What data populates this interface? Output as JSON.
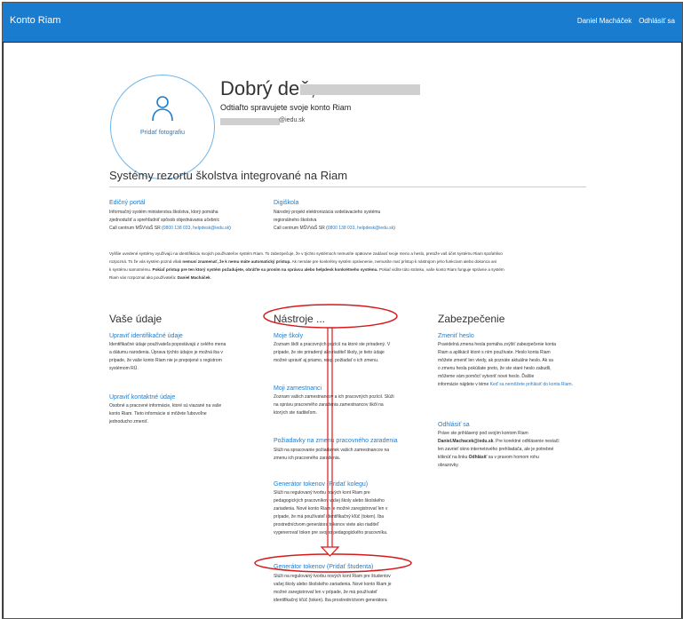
{
  "header": {
    "brand": "Konto Riam",
    "user_name": "Daniel Macháček",
    "logout": "Odhlásiť sa"
  },
  "profile": {
    "add_photo": "Pridať fotografiu",
    "greeting": "Dobrý deň,",
    "subtitle": "Odtiaľto spravujete svoje konto Riam",
    "email_suffix": "@iedu.sk"
  },
  "systems": {
    "title": "Systémy rezortu školstva integrované na Riam",
    "items": [
      {
        "title": "Edičný portál",
        "line1": "Informačný systém ministerstva školstva, ktorý pomáha",
        "line2": "zjednodušiť a sprehľadniť spôsob objednávania učebníc",
        "line3_prefix": "Call centrum MŠVVaŠ SR (",
        "line3_link": "0800 138 033, helpdesk@iedu.sk",
        "line3_suffix": ")"
      },
      {
        "title": "Digiškola",
        "line1": "Národný projekt elektronizácia vzdelávacieho systému",
        "line2": "regionálneho školstva",
        "line3_prefix": "Call centrum MŠVVaŠ SR (",
        "line3_link": "0800 138 033, helpdesk@iedu.sk",
        "line3_suffix": ")"
      }
    ],
    "note": {
      "line1": "Vyššie uvedené systémy využívajú na identifikáciu svojich používateľov systém Riam. To zabezpečuje, že v týchto systémoch nemusíte opätovne zadávať svoje meno a heslo, pretože vaš účet systému Riam spoľahlivo",
      "line2_a": "rozpozná. To že vás systém pozná však ",
      "line2_bold": "nemusí znamenať, že k nemu máte automatický prístup.",
      "line2_b": " Ak nemáte pre konkrétny systém oprávnenie, nemusíte mať prístup k nástrojom jeho funkcíam alebo dokonca ani",
      "line3_a": "k systému samotnému. ",
      "line3_bold": "Pokiaľ prístup pre ten ktorý systém požadujete, obráťte sa prosím na správcu alebo helpdesk konkrétneho systému.",
      "line3_b": " Pokiaľ vidíte túto stránku, vaše konto Riam funguje správne a systém",
      "line4_a": "Riam vás rozpoznal ako používateľa: ",
      "line4_bold": "Daniel Macháček",
      "line4_b": "."
    }
  },
  "columns": {
    "udaje": {
      "title": "Vaše údaje",
      "items": [
        {
          "title": "Upraviť identifikačné údaje",
          "lines": [
            "Identifikačné údaje používateľa popostávajú z celého mena",
            "a dátumu narodenia. Úprava týchto údajov je možná iba v",
            "prípade, že vaše konto Riam nie je prepojené s registrom",
            "systémom RÚ."
          ]
        },
        {
          "title": "Upraviť kontaktné údaje",
          "lines": [
            "Osobné a pracovné informácie, ktoré sú viazané na vaše",
            "konto Riam. Tieto informácie si môžete ľubovoľne",
            "jednoducho zmeniť."
          ]
        }
      ]
    },
    "nastroje": {
      "title": "Nástroje ...",
      "items": [
        {
          "title": "Moje školy",
          "lines": [
            "Zoznam škôl a pracovných pozícií na ktoré ste priradený. V",
            "prípade, že ste priradený ako riaditeľ školy, je tieto údaje",
            "možné upraviť aj priamo, resp. požiadať o ich zmenu."
          ]
        },
        {
          "title": "Moji zamestnanci",
          "lines": [
            "Zoznam vašich zamestnancov a ich pracovných pozícií. Slúži",
            "na správu pracovného zaradenia zamestnancov škôl na",
            "ktorých ste riaditeľom."
          ]
        },
        {
          "title": "Požiadavky na zmenu pracovného zaradenia",
          "lines": [
            "Slúži na spracovanie požiadaviek vašich zamestnancov na",
            "zmenu ich pracovného zaradenia."
          ]
        },
        {
          "title": "Generátor tokenov (Pridať kolegu)",
          "lines": [
            "Slúži na regulovaný tvorbu nových kont Riam pre",
            "pedagogických pracovníkov vašej školy alebo školského",
            "zariadenia. Nové konto Riam je možné zaregistrovať len v",
            "prípade, že má používateľ identifikačný kľúč (token). Iba",
            "prostredníctvom generátora tokenov viete ako riaditeľ",
            "vygenerovať token pre svojho pedagogického pracovníka."
          ]
        },
        {
          "title": "Generátor tokenov (Pridať študenta)",
          "lines": [
            "Slúži na regulovaný tvorbu nových kont Riam pre študentov",
            "vašej školy alebo školského zariadenia. Nové konto Riam je",
            "možné zaregistrovať len v prípade, že má používateľ",
            "identifikačný kľúč (token). Iba prostredníctvom generátora"
          ]
        }
      ]
    },
    "zabezpecenie": {
      "title": "Zabezpečenie",
      "items": [
        {
          "title": "Zmeniť heslo",
          "lines": [
            "Pravidelná zmena hesla pomáha zvýšiť zabezpečenie konta",
            "Riam a aplikácií ktoré s ním používate. Heslo konta Riam",
            "môžete zmeniť len vtedy, ak poznáte aktuálne heslo. Ak sa",
            "o zmenu hesla pokúšate preto, že ste staré heslo zabudli,",
            "môžeme vám pomôcť vytvoriť nové heslo. Ďalšie",
            "informácie nájdete v téme "
          ],
          "link": "Keď sa nemôžete prihlásiť do konta Riam",
          "link_suffix": "."
        },
        {
          "title": "Odhlásiť sa",
          "line1": "Práve ste prihlásený pod svojím kontom Riam",
          "line2_bold": "Daniel.Machacek@iedu.sk",
          "line2_b": ". Pre korektné odhlásenie nestačí",
          "line3": "len zavrieť okno internetového prehliadača, ale je potrebné",
          "line4_a": "kliknúť na linku ",
          "line4_bold": "Odhlásiť",
          "line4_b": " sa v pravom hornom rohu",
          "line5": "obrazovky."
        }
      ]
    }
  },
  "colors": {
    "topbar": "#1a7ccf",
    "link": "#1a7ccf",
    "annotation": "#d7191c"
  }
}
